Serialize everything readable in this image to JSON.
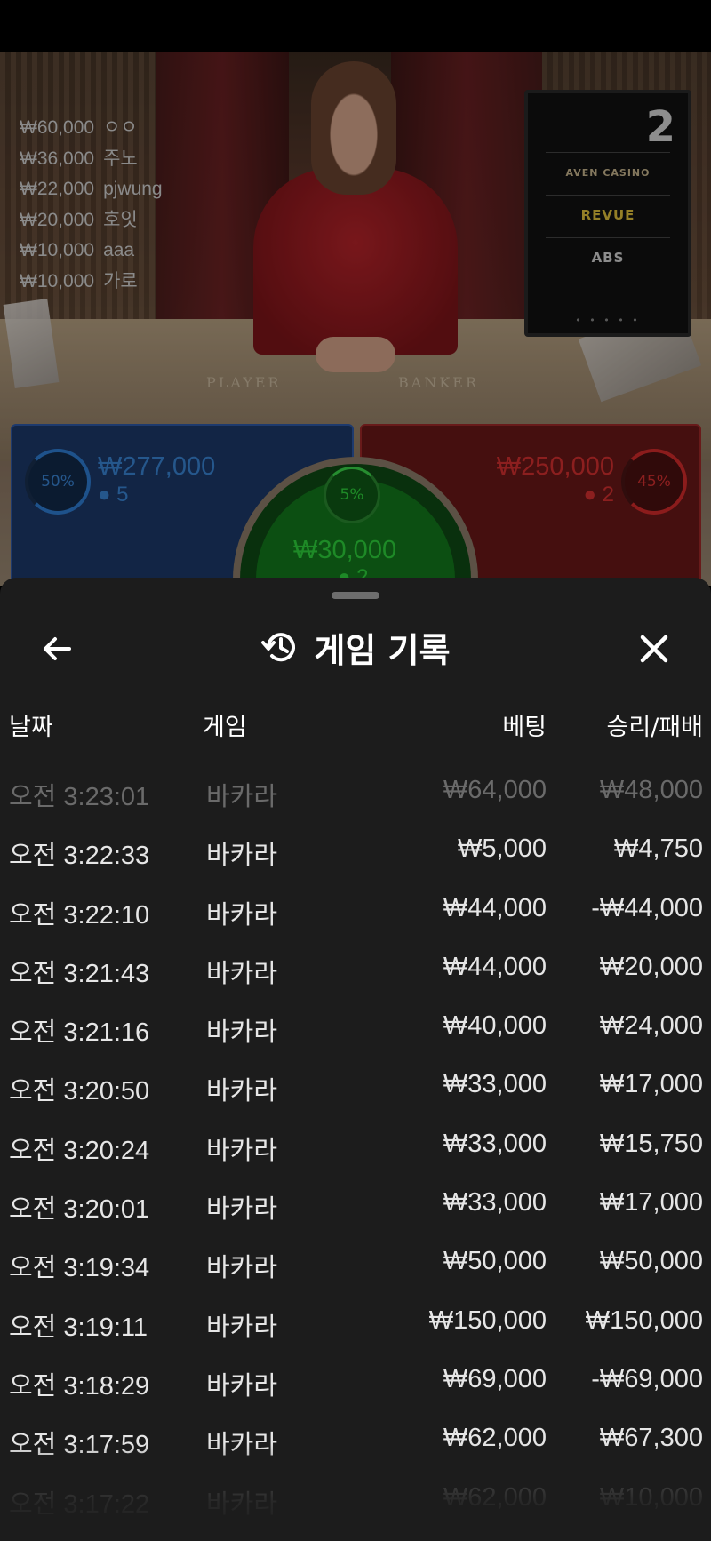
{
  "video": {
    "table_labels": [
      "PLAYER",
      "BANKER"
    ],
    "screen": {
      "number": "2",
      "logos": [
        "AVEN CASINO",
        "REVUE",
        "ABS"
      ]
    },
    "top_bets": [
      {
        "amount": "₩60,000",
        "name": "ㅇㅇ"
      },
      {
        "amount": "₩36,000",
        "name": "주노"
      },
      {
        "amount": "₩22,000",
        "name": "pjwung"
      },
      {
        "amount": "₩20,000",
        "name": "호잇"
      },
      {
        "amount": "₩10,000",
        "name": "aaa"
      },
      {
        "amount": "₩10,000",
        "name": "가로"
      }
    ]
  },
  "bet_tiles": {
    "player": {
      "percent": "50%",
      "amount": "₩277,000",
      "players": "5",
      "color": "#2f7fd6"
    },
    "banker": {
      "percent": "45%",
      "amount": "₩250,000",
      "players": "2",
      "color": "#d62b2b"
    },
    "tie": {
      "percent": "5%",
      "amount": "₩30,000",
      "players": "2",
      "color": "#2ed43c"
    }
  },
  "sheet": {
    "title": "게임 기록",
    "icons": {
      "back": "arrow-left-icon",
      "history": "history-icon",
      "close": "close-icon"
    },
    "columns": {
      "date": "날짜",
      "game": "게임",
      "bet": "베팅",
      "win_loss": "승리/패배"
    },
    "rows": [
      {
        "date": "오전 3:23:01",
        "game": "바카라",
        "bet": "₩64,000",
        "win_loss": "₩48,000"
      },
      {
        "date": "오전 3:22:33",
        "game": "바카라",
        "bet": "₩5,000",
        "win_loss": "₩4,750"
      },
      {
        "date": "오전 3:22:10",
        "game": "바카라",
        "bet": "₩44,000",
        "win_loss": "-₩44,000"
      },
      {
        "date": "오전 3:21:43",
        "game": "바카라",
        "bet": "₩44,000",
        "win_loss": "₩20,000"
      },
      {
        "date": "오전 3:21:16",
        "game": "바카라",
        "bet": "₩40,000",
        "win_loss": "₩24,000"
      },
      {
        "date": "오전 3:20:50",
        "game": "바카라",
        "bet": "₩33,000",
        "win_loss": "₩17,000"
      },
      {
        "date": "오전 3:20:24",
        "game": "바카라",
        "bet": "₩33,000",
        "win_loss": "₩15,750"
      },
      {
        "date": "오전 3:20:01",
        "game": "바카라",
        "bet": "₩33,000",
        "win_loss": "₩17,000"
      },
      {
        "date": "오전 3:19:34",
        "game": "바카라",
        "bet": "₩50,000",
        "win_loss": "₩50,000"
      },
      {
        "date": "오전 3:19:11",
        "game": "바카라",
        "bet": "₩150,000",
        "win_loss": "₩150,000"
      },
      {
        "date": "오전 3:18:29",
        "game": "바카라",
        "bet": "₩69,000",
        "win_loss": "-₩69,000"
      },
      {
        "date": "오전 3:17:59",
        "game": "바카라",
        "bet": "₩62,000",
        "win_loss": "₩67,300"
      },
      {
        "date": "오전 3:17:22",
        "game": "바카라",
        "bet": "₩62,000",
        "win_loss": "₩10,000"
      }
    ]
  }
}
